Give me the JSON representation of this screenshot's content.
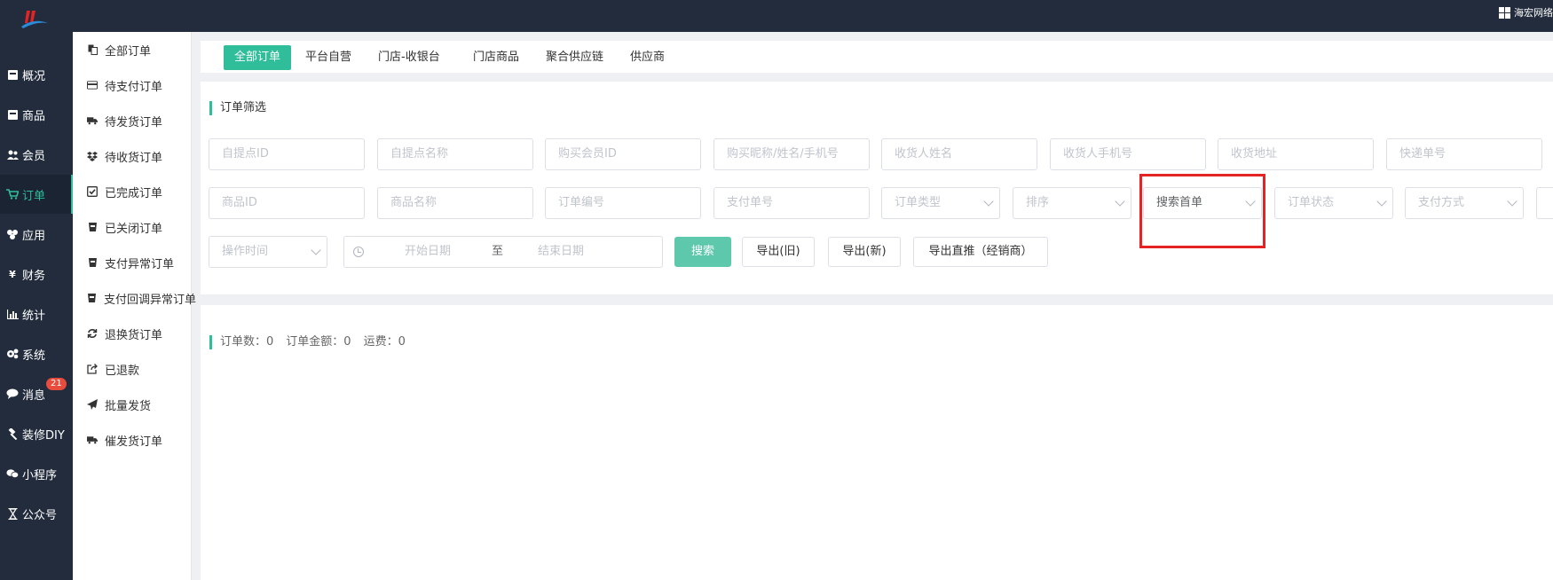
{
  "header": {
    "org_name": "海宏网络"
  },
  "sidebar": {
    "items": [
      {
        "label": "概况",
        "icon": "dashboard-icon"
      },
      {
        "label": "商品",
        "icon": "goods-icon"
      },
      {
        "label": "会员",
        "icon": "members-icon"
      },
      {
        "label": "订单",
        "icon": "cart-icon",
        "active": true
      },
      {
        "label": "应用",
        "icon": "apps-icon"
      },
      {
        "label": "财务",
        "icon": "yen-icon"
      },
      {
        "label": "统计",
        "icon": "bar-chart-icon"
      },
      {
        "label": "系统",
        "icon": "gears-icon"
      },
      {
        "label": "消息",
        "icon": "chat-icon",
        "badge": "21"
      },
      {
        "label": "装修DIY",
        "icon": "hammer-icon"
      },
      {
        "label": "小程序",
        "icon": "wechat-icon"
      },
      {
        "label": "公众号",
        "icon": "hourglass-icon"
      }
    ]
  },
  "submenu": {
    "items": [
      {
        "label": "全部订单",
        "icon": "copy-icon"
      },
      {
        "label": "待支付订单",
        "icon": "credit-card-icon"
      },
      {
        "label": "待发货订单",
        "icon": "truck-icon"
      },
      {
        "label": "待收货订单",
        "icon": "dropbox-icon"
      },
      {
        "label": "已完成订单",
        "icon": "check-square-icon"
      },
      {
        "label": "已关闭订单",
        "icon": "cup-icon"
      },
      {
        "label": "支付异常订单",
        "icon": "cup-icon"
      },
      {
        "label": "支付回调异常订单",
        "icon": "cup-icon"
      },
      {
        "label": "退换货订单",
        "icon": "refresh-icon"
      },
      {
        "label": "已退款",
        "icon": "share-square-icon"
      },
      {
        "label": "批量发货",
        "icon": "paper-plane-icon"
      },
      {
        "label": "催发货订单",
        "icon": "truck-icon"
      }
    ]
  },
  "tabs": [
    "全部订单",
    "平台自营",
    "门店-收银台",
    "门店商品",
    "聚合供应链",
    "供应商"
  ],
  "filter": {
    "title": "订单筛选",
    "row1": [
      "自提点ID",
      "自提点名称",
      "购买会员ID",
      "购买昵称/姓名/手机号",
      "收货人姓名",
      "收货人手机号",
      "收货地址",
      "快递单号"
    ],
    "row2_inputs": [
      "商品ID",
      "商品名称",
      "订单编号",
      "支付单号"
    ],
    "order_type": "订单类型",
    "sort": "排序",
    "search_scope": "搜索首单",
    "order_status": "订单状态",
    "pay_method": "支付方式",
    "op_time": "操作时间",
    "start_date": "开始日期",
    "to": "至",
    "end_date": "结束日期",
    "buttons": {
      "search": "搜索",
      "export_old": "导出(旧)",
      "export_new": "导出(新)",
      "export_direct": "导出直推（经销商）"
    }
  },
  "stats": {
    "order_count": "订单数：0",
    "order_amount": "订单金额：0",
    "freight": "运费：0"
  },
  "colors": {
    "sidebar_bg": "#222c3c",
    "accent": "#2fbd9a",
    "highlight": "#e52323"
  }
}
